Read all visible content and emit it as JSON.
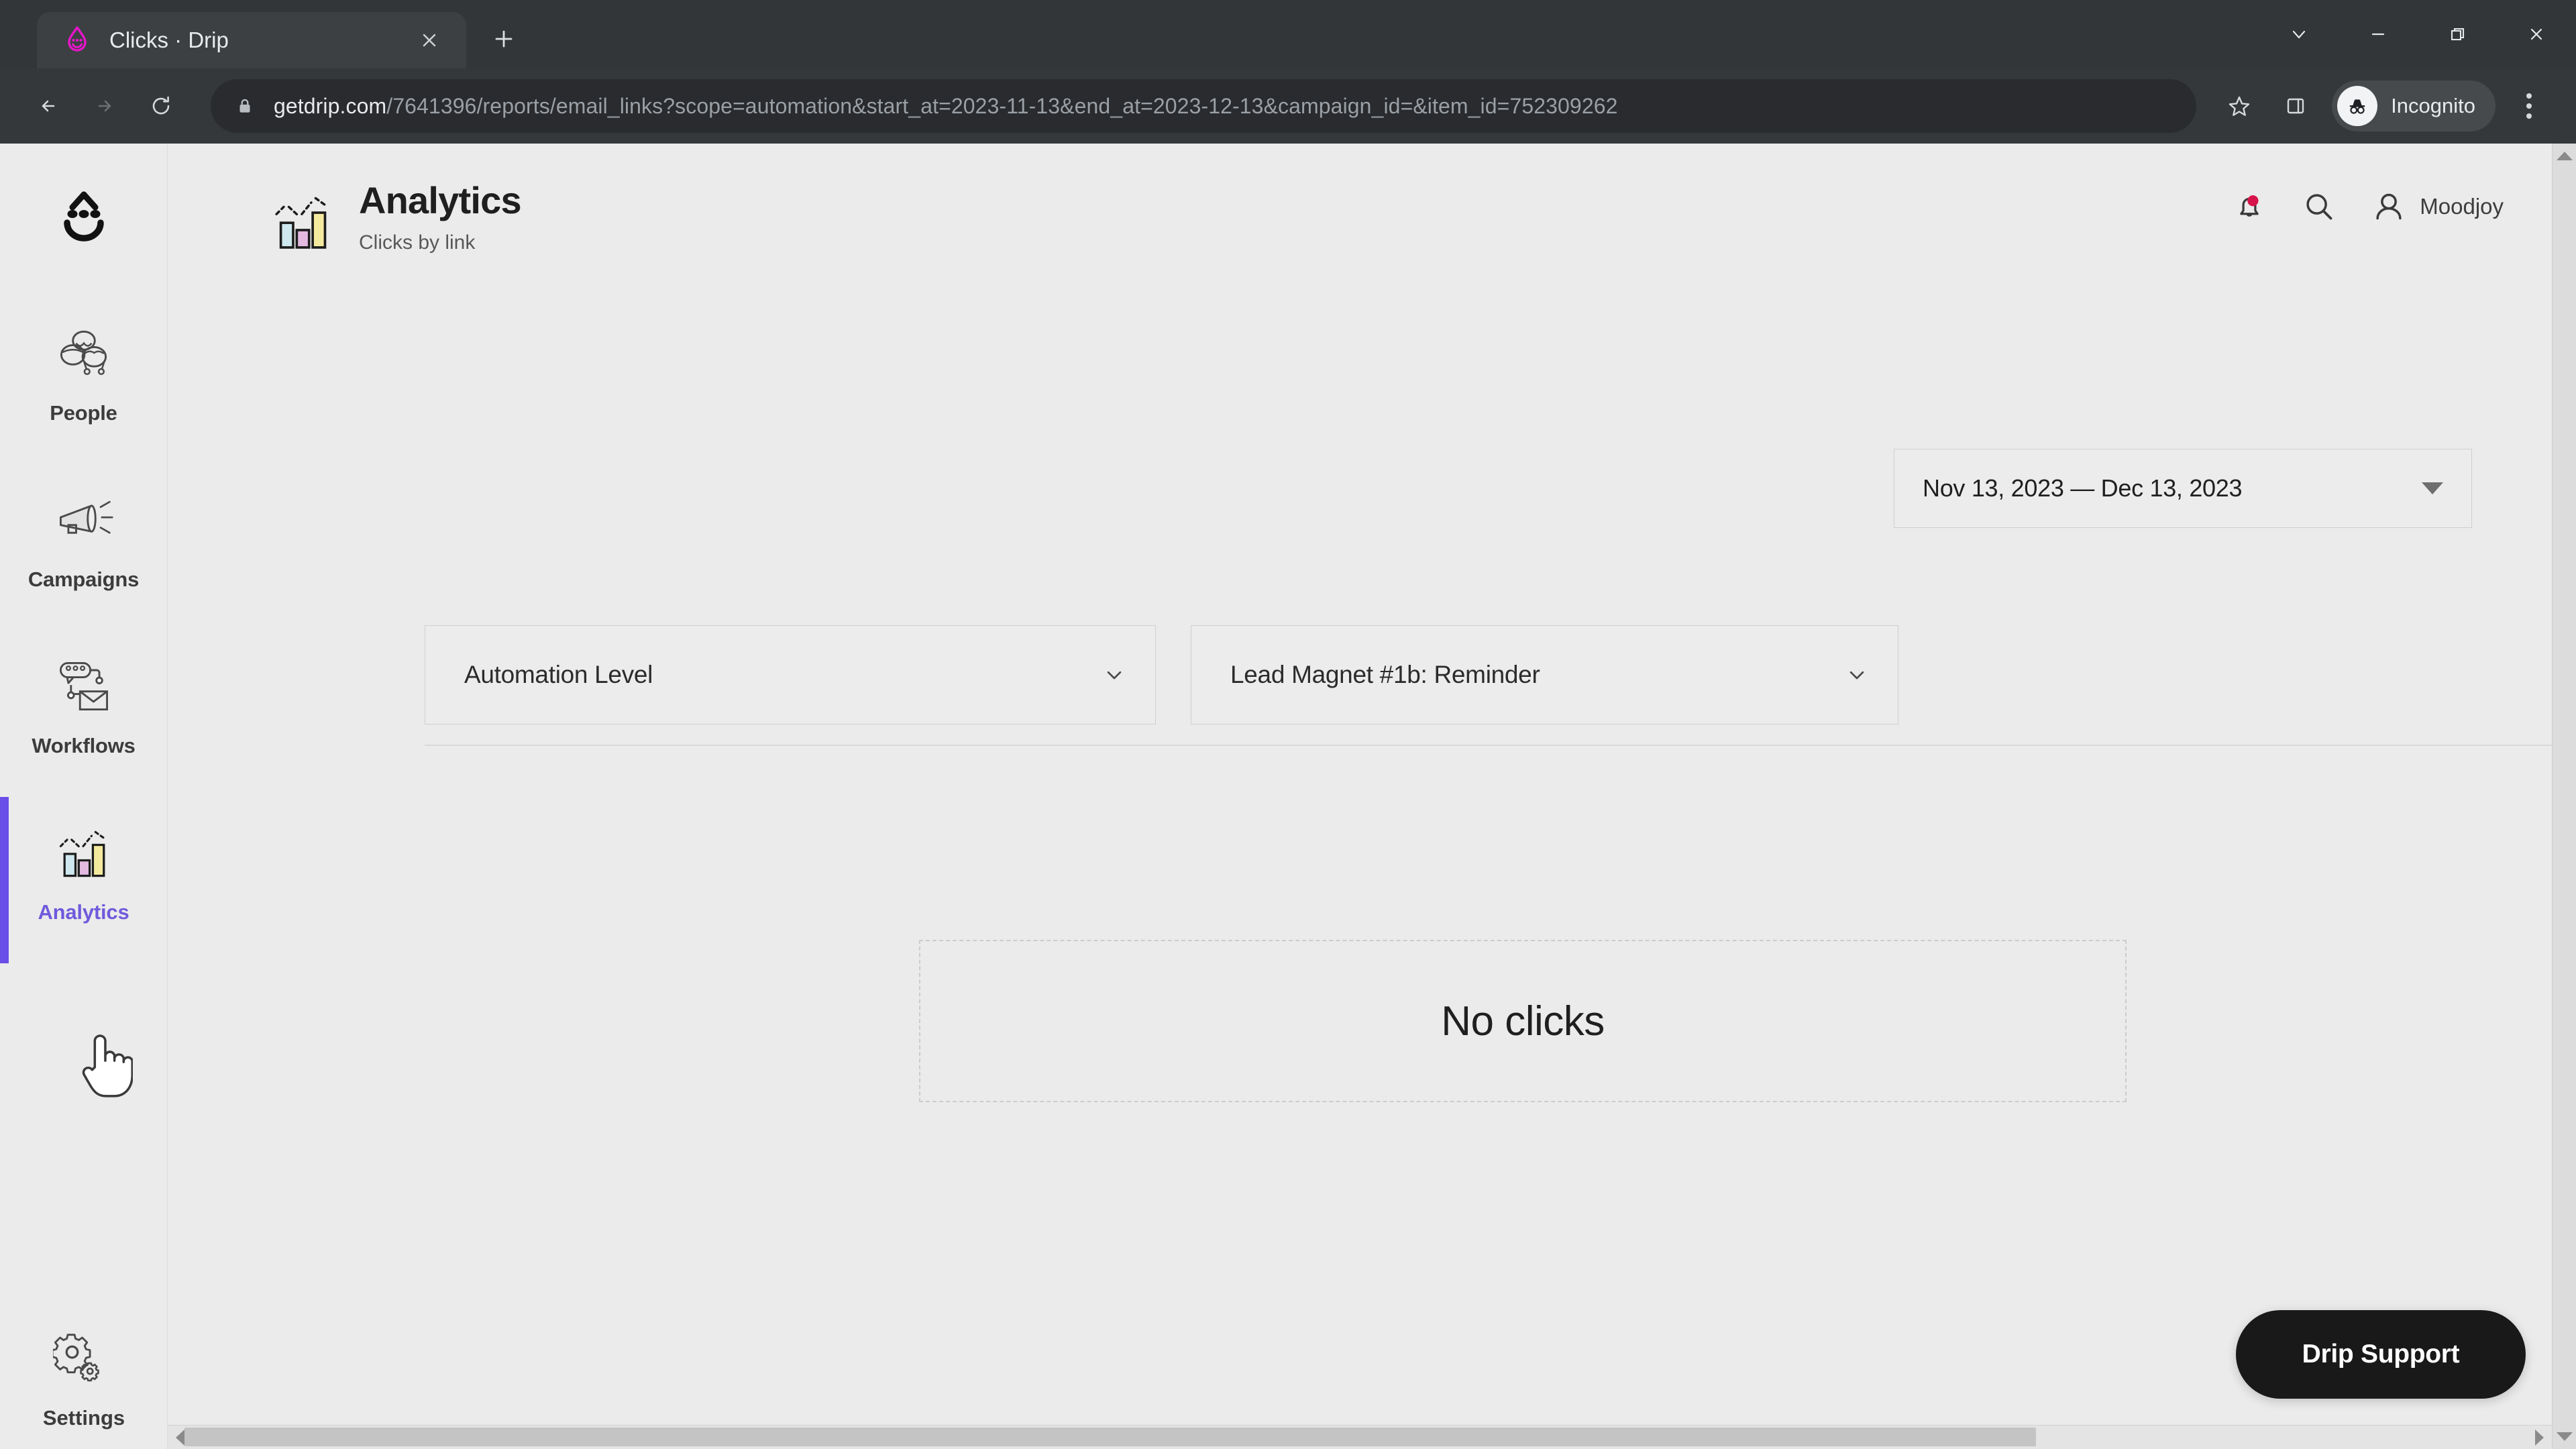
{
  "browser": {
    "tab": {
      "title": "Clicks · Drip",
      "favicon": "drip-logo-icon",
      "close_label": "×"
    },
    "new_tab_label": "+",
    "window_controls": [
      {
        "name": "tab-search",
        "glyph": "chevron-down-icon"
      },
      {
        "name": "minimize",
        "glyph": "minimize-icon"
      },
      {
        "name": "restore",
        "glyph": "restore-icon"
      },
      {
        "name": "close",
        "glyph": "close-icon"
      }
    ],
    "toolbar": {
      "back_label": "back-arrow-icon",
      "forward_label": "forward-arrow-icon",
      "reload_label": "reload-icon",
      "lock_label": "lock-icon",
      "url_host": "getdrip.com",
      "url_path": "/7641396/reports/email_links?scope=automation&start_at=2023-11-13&end_at=2023-12-13&campaign_id=&item_id=752309262",
      "url_full": "getdrip.com/7641396/reports/email_links?scope=automation&start_at=2023-11-13&end_at=2023-12-13&campaign_id=&item_id=752309262",
      "bookmark_label": "star-icon",
      "side_panel_label": "side-panel-icon",
      "incognito_label": "Incognito",
      "menu_label": "three-dot-menu-icon"
    }
  },
  "sidebar": {
    "brand": "drip-smiley-logo",
    "items": [
      {
        "label": "People",
        "icon": "people-icon",
        "active": false
      },
      {
        "label": "Campaigns",
        "icon": "megaphone-icon",
        "active": false
      },
      {
        "label": "Workflows",
        "icon": "workflow-icon",
        "active": false
      },
      {
        "label": "Analytics",
        "icon": "bar-chart-icon",
        "active": true
      }
    ],
    "settings": {
      "label": "Settings",
      "icon": "gear-icon"
    }
  },
  "header": {
    "icon": "bar-chart-icon",
    "title": "Analytics",
    "subtitle": "Clicks by link",
    "notifications_icon": "bell-icon",
    "notifications_badge": true,
    "search_icon": "search-icon",
    "user_icon": "person-icon",
    "username": "Moodjoy"
  },
  "controls": {
    "date_range": {
      "value": "Nov 13, 2023 — Dec 13, 2023",
      "caret": "caret-down-icon"
    },
    "filters": [
      {
        "name": "automation-level",
        "value": "Automation Level",
        "caret": "chevron-down-icon"
      },
      {
        "name": "lead-magnet",
        "value": "Lead Magnet #1b: Reminder",
        "caret": "chevron-down-icon"
      }
    ]
  },
  "content": {
    "empty_state_text": "No clicks"
  },
  "support": {
    "label": "Drip Support"
  },
  "colors": {
    "accent_purple": "#6a4ee8",
    "active_text": "#6f5bdc",
    "page_bg": "#ebebeb",
    "chrome_bg": "#35383b",
    "titlebar_bg": "#323639",
    "notification_red": "#d8124a",
    "support_bg": "#191919",
    "drip_magenta": "#e516c9"
  }
}
